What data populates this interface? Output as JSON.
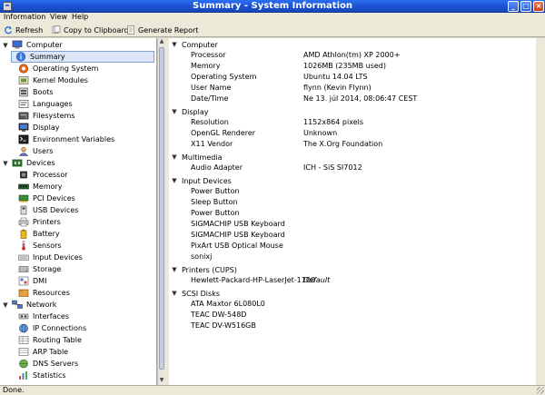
{
  "window": {
    "title": "Summary - System Information",
    "buttons": {
      "minimize": "_",
      "maximize": "□",
      "close": "×"
    }
  },
  "menu": [
    {
      "label": "Information",
      "underline": "I"
    },
    {
      "label": "View",
      "underline": "V"
    },
    {
      "label": "Help",
      "underline": "H"
    }
  ],
  "toolbar": {
    "refresh": "Refresh",
    "copy": "Copy to Clipboard",
    "report": "Generate Report"
  },
  "tree": {
    "computer": "Computer",
    "computer_children": [
      "Summary",
      "Operating System",
      "Kernel Modules",
      "Boots",
      "Languages",
      "Filesystems",
      "Display",
      "Environment Variables",
      "Users"
    ],
    "devices": "Devices",
    "devices_children": [
      "Processor",
      "Memory",
      "PCI Devices",
      "USB Devices",
      "Printers",
      "Battery",
      "Sensors",
      "Input Devices",
      "Storage",
      "DMI",
      "Resources"
    ],
    "network": "Network",
    "network_children": [
      "Interfaces",
      "IP Connections",
      "Routing Table",
      "ARP Table",
      "DNS Servers",
      "Statistics"
    ],
    "selected": "Summary"
  },
  "details": {
    "computer": {
      "header": "Computer",
      "rows": [
        {
          "key": "Processor",
          "value": "AMD Athlon(tm) XP 2000+"
        },
        {
          "key": "Memory",
          "value": "1026MB (235MB used)"
        },
        {
          "key": "Operating System",
          "value": "Ubuntu 14.04 LTS"
        },
        {
          "key": "User Name",
          "value": "flynn (Kevin Flynn)"
        },
        {
          "key": "Date/Time",
          "value": "Ne 13. júl 2014, 08:06:47 CEST"
        }
      ]
    },
    "display": {
      "header": "Display",
      "rows": [
        {
          "key": "Resolution",
          "value": "1152x864 pixels"
        },
        {
          "key": "OpenGL Renderer",
          "value": "Unknown"
        },
        {
          "key": "X11 Vendor",
          "value": "The X.Org Foundation"
        }
      ]
    },
    "multimedia": {
      "header": "Multimedia",
      "rows": [
        {
          "key": "Audio Adapter",
          "value": "ICH - SiS SI7012"
        }
      ]
    },
    "input": {
      "header": "Input Devices",
      "rows": [
        "Power Button",
        "Sleep Button",
        "Power Button",
        "SIGMACHIP USB Keyboard",
        "SIGMACHIP USB Keyboard",
        "PixArt USB Optical Mouse",
        "sonixj"
      ]
    },
    "printers": {
      "header": "Printers (CUPS)",
      "rows": [
        {
          "key": "Hewlett-Packard-HP-LaserJet-1100",
          "value": "Default"
        }
      ]
    },
    "scsi": {
      "header": "SCSI Disks",
      "rows": [
        "ATA Maxtor 6L080L0",
        "TEAC DW-548D",
        "TEAC DV-W516GB"
      ]
    }
  },
  "status": "Done.",
  "colors": {
    "titlebar": "#1a4fcf",
    "selection": "#dce6f8"
  }
}
